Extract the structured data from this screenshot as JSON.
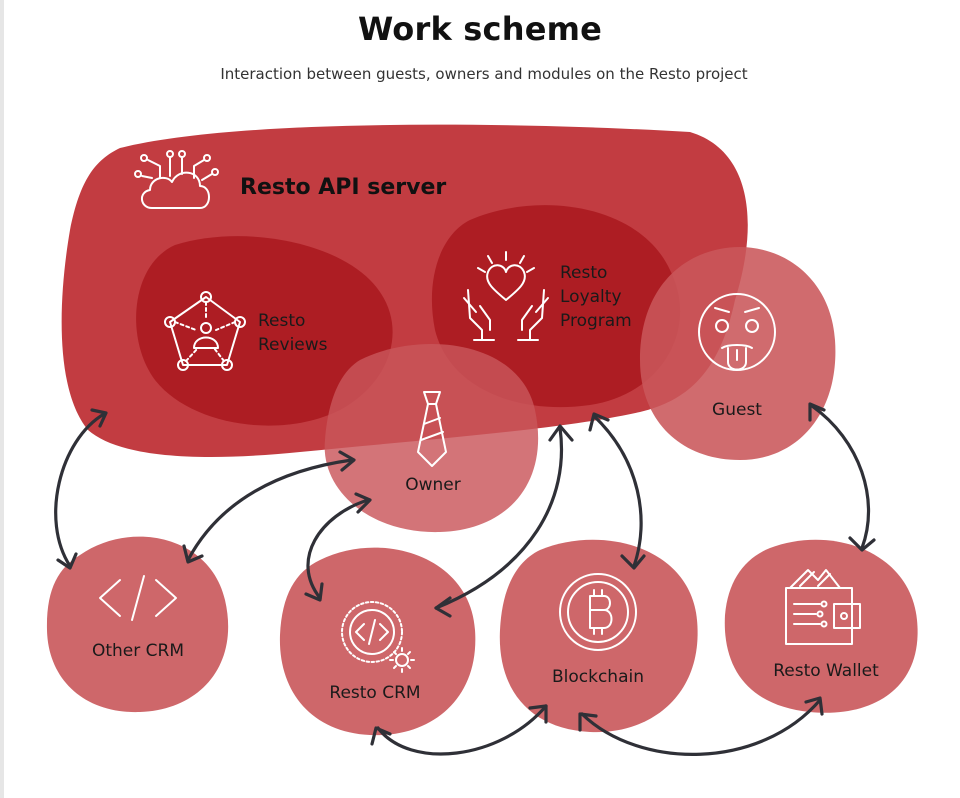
{
  "header": {
    "title": "Work scheme",
    "subtitle": "Interaction between guests, owners and modules on the Resto project"
  },
  "diagram": {
    "server": {
      "label": "Resto API server",
      "icon": "cloud-circuit-icon"
    },
    "reviews": {
      "line1": "Resto",
      "line2": "Reviews",
      "icon": "network-pentagon-icon"
    },
    "loyalty": {
      "line1": "Resto",
      "line2": "Loyalty",
      "line3": "Program",
      "icon": "hands-heart-icon"
    },
    "guest": {
      "label": "Guest",
      "icon": "tongue-face-icon"
    },
    "owner": {
      "label": "Owner",
      "icon": "tie-icon"
    },
    "other_crm": {
      "label": "Other CRM",
      "icon": "code-brackets-icon"
    },
    "resto_crm": {
      "label": "Resto CRM",
      "icon": "code-gear-icon"
    },
    "blockchain": {
      "label": "Blockchain",
      "icon": "bitcoin-icon"
    },
    "wallet": {
      "label": "Resto Wallet",
      "icon": "wallet-icon"
    },
    "colors": {
      "server_fill": "#b81c22",
      "inner_fill": "#a8151b",
      "node_fill": "#c9565a",
      "arrow": "#2f3037"
    }
  }
}
